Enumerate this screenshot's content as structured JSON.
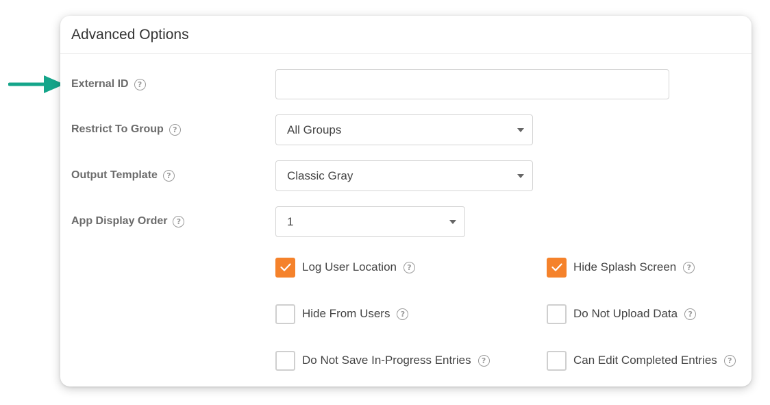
{
  "card": {
    "title": "Advanced Options"
  },
  "fields": {
    "external_id": {
      "label": "External ID",
      "value": "",
      "placeholder": ""
    },
    "restrict_group": {
      "label": "Restrict To Group",
      "value": "All Groups"
    },
    "output_template": {
      "label": "Output Template",
      "value": "Classic Gray"
    },
    "display_order": {
      "label": "App Display Order",
      "value": "1"
    }
  },
  "help_glyph": "?",
  "checkboxes": [
    {
      "label": "Log User Location",
      "checked": true
    },
    {
      "label": "Hide Splash Screen",
      "checked": true
    },
    {
      "label": "Hide From Users",
      "checked": false
    },
    {
      "label": "Do Not Upload Data",
      "checked": false
    },
    {
      "label": "Do Not Save In-Progress Entries",
      "checked": false
    },
    {
      "label": "Can Edit Completed Entries",
      "checked": false
    }
  ],
  "colors": {
    "accent": "#f5822b",
    "pointer_arrow": "#15a58a"
  },
  "icons": {
    "pointer": "arrow-right-icon",
    "help": "question-circle-icon",
    "dropdown": "caret-down-icon",
    "check": "checkmark-icon"
  }
}
